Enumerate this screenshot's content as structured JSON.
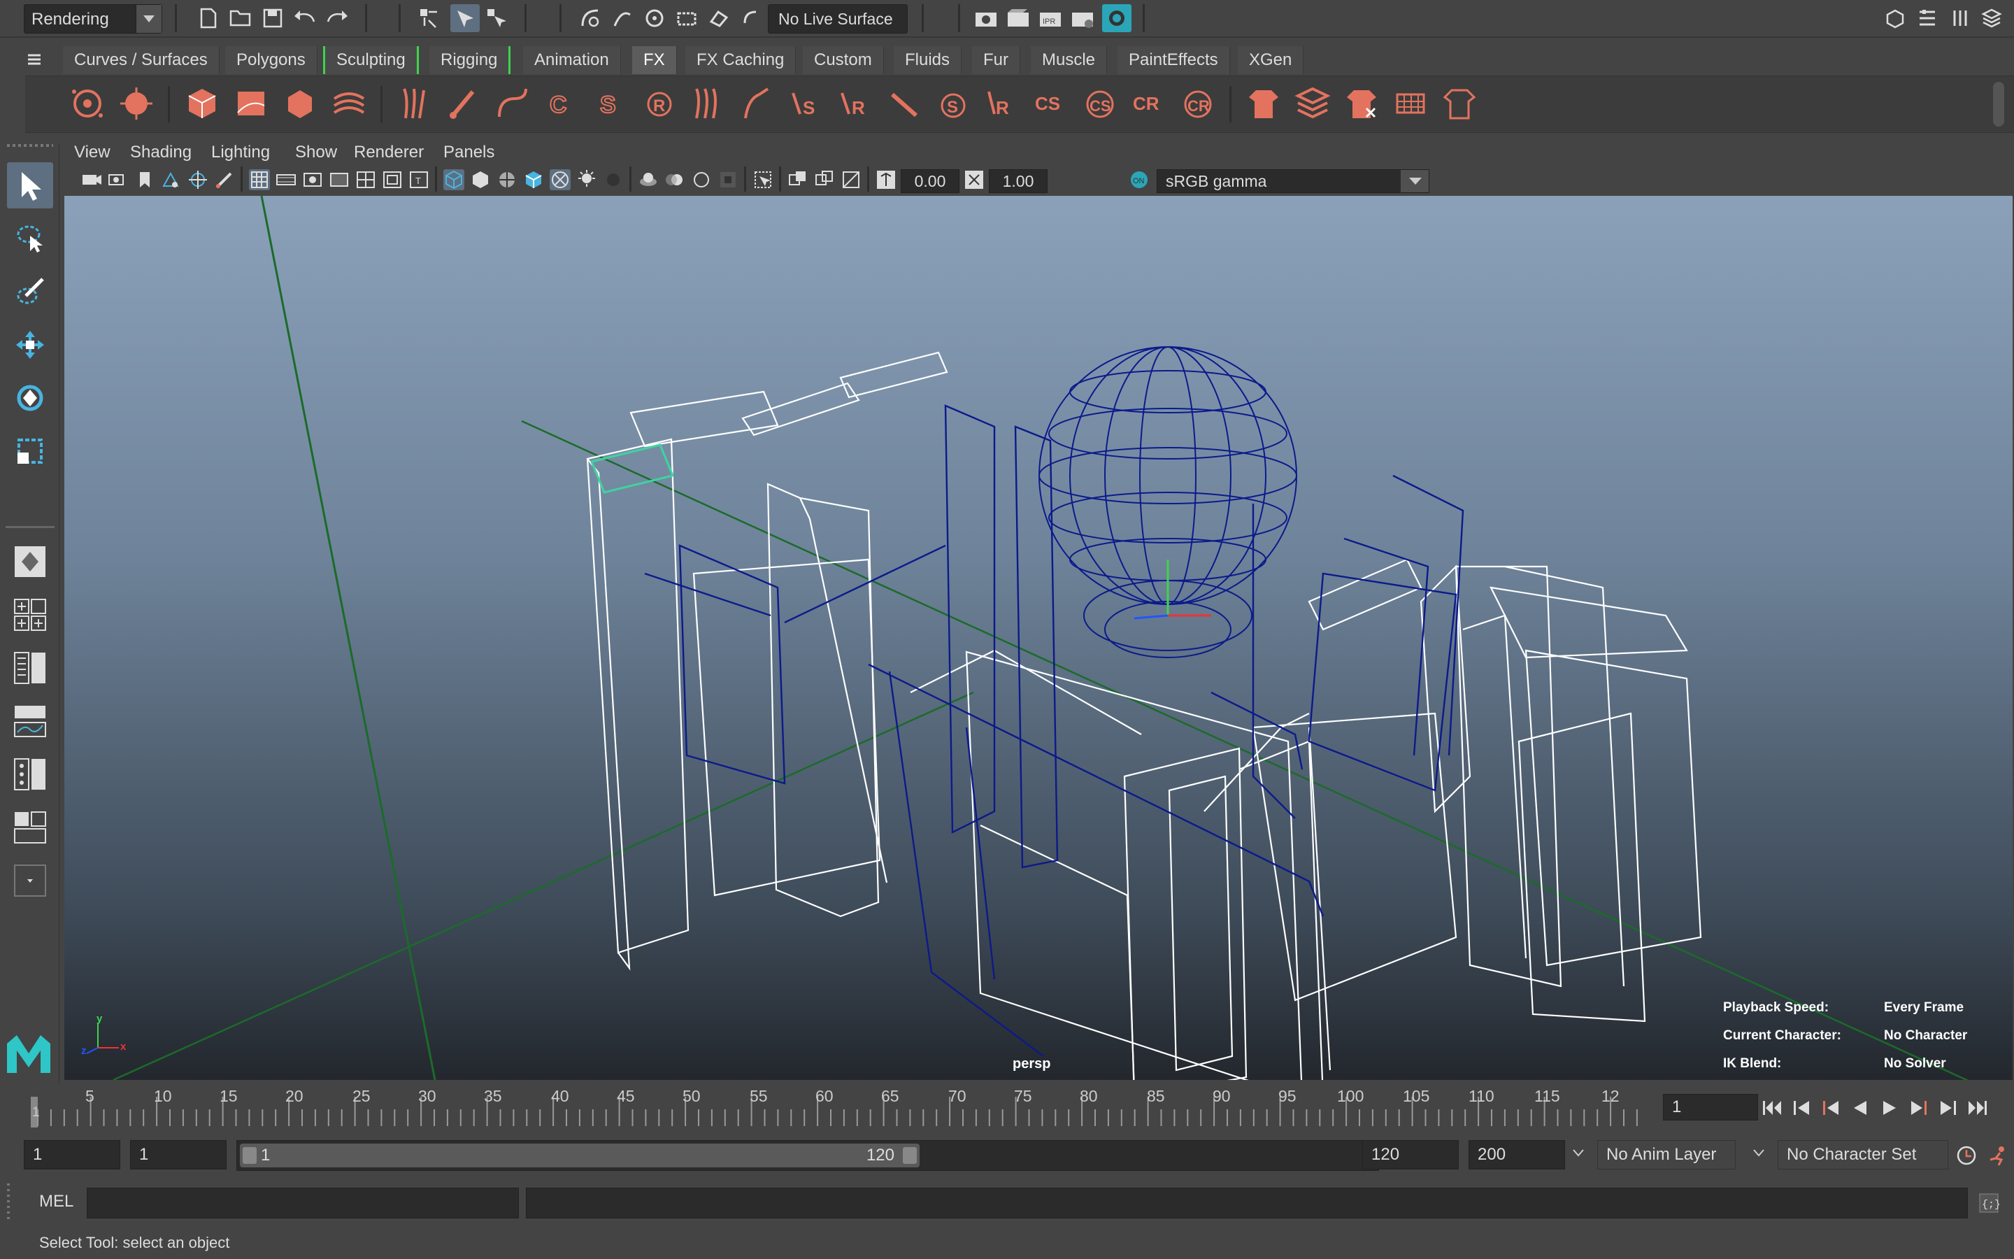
{
  "statusline": {
    "menuset": "Rendering",
    "live_surface": "No Live Surface"
  },
  "shelf_tabs": [
    {
      "label": "Curves / Surfaces"
    },
    {
      "label": "Polygons"
    },
    {
      "label": "Sculpting"
    },
    {
      "label": "Rigging"
    },
    {
      "label": "Animation"
    },
    {
      "label": "FX",
      "active": true
    },
    {
      "label": "FX Caching"
    },
    {
      "label": "Custom"
    },
    {
      "label": "Fluids"
    },
    {
      "label": "Fur"
    },
    {
      "label": "Muscle"
    },
    {
      "label": "PaintEffects"
    },
    {
      "label": "XGen"
    }
  ],
  "panel_menu": [
    "View",
    "Shading",
    "Lighting",
    "Show",
    "Renderer",
    "Panels"
  ],
  "panel_toolbar": {
    "exposure": "0.00",
    "gamma_value": "1.00",
    "color_space": "sRGB gamma"
  },
  "viewport": {
    "camera": "persp",
    "hud": {
      "playback_speed_label": "Playback Speed:",
      "playback_speed_value": "Every Frame",
      "current_character_label": "Current Character:",
      "current_character_value": "No Character",
      "ik_blend_label": "IK Blend:",
      "ik_blend_value": "No Solver"
    },
    "axis_labels": {
      "y": "y",
      "x": "x",
      "z": "z"
    }
  },
  "timeline": {
    "ticks": [
      "1",
      "5",
      "10",
      "15",
      "20",
      "25",
      "30",
      "35",
      "40",
      "45",
      "50",
      "55",
      "60",
      "65",
      "70",
      "75",
      "80",
      "85",
      "90",
      "95",
      "100",
      "105",
      "110",
      "115",
      "12"
    ],
    "current_frame": "1"
  },
  "range": {
    "start_time": "1",
    "playback_start": "1",
    "range_start_label": "1",
    "range_end_label": "120",
    "playback_end": "120",
    "end_time": "200",
    "anim_layer": "No Anim Layer",
    "character_set": "No Character Set"
  },
  "command_line": {
    "mode": "MEL"
  },
  "help_line": "Select Tool: select an object",
  "colors": {
    "accent_select": "#5d6f80",
    "shelf_icon": "#e3735e",
    "wire_selected": "#0c1a8a",
    "wire_unselected": "#ffffff"
  }
}
